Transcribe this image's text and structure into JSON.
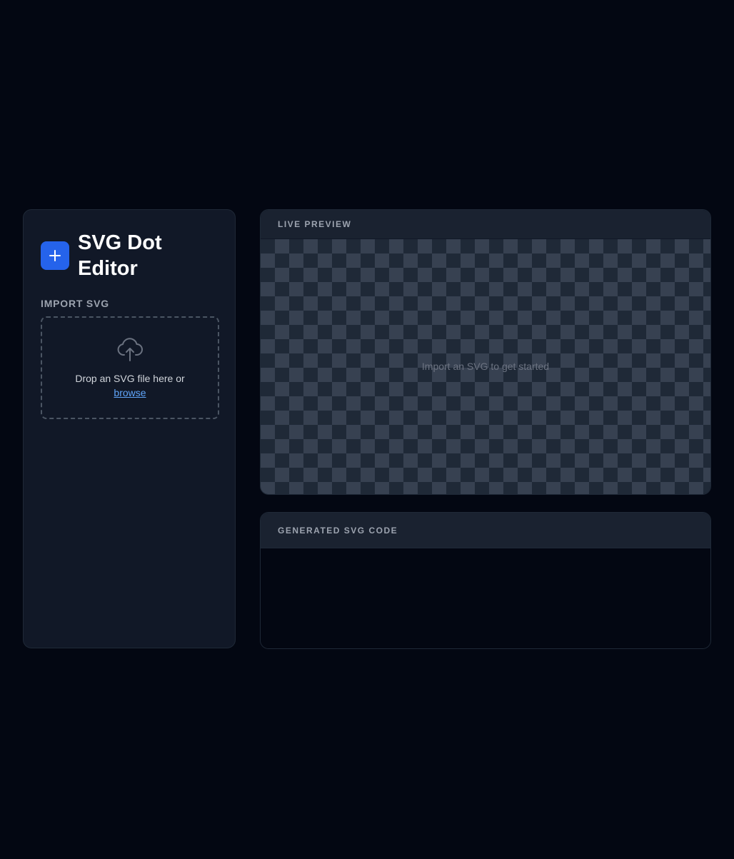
{
  "app": {
    "title": "SVG Dot Editor",
    "logo_icon": "plus-icon",
    "accent_color": "#2563eb"
  },
  "import": {
    "section_label": "IMPORT SVG",
    "upload_icon": "cloud-upload-icon",
    "drop_text": "Drop an SVG file here or",
    "browse_label": "browse"
  },
  "preview": {
    "header": "LIVE PREVIEW",
    "empty_message": "Import an SVG to get started"
  },
  "code": {
    "header": "GENERATED SVG CODE",
    "content": ""
  }
}
